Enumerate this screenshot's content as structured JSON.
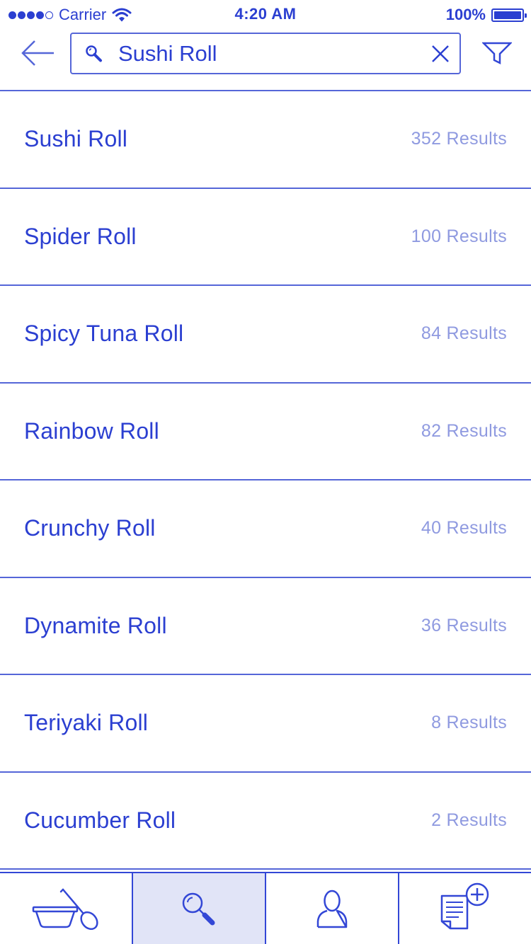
{
  "status_bar": {
    "carrier": "Carrier",
    "time": "4:20 AM",
    "battery": "100%",
    "battery_level": 1.0,
    "signal_bars_filled": 4,
    "signal_bars_total": 5
  },
  "header": {
    "search": {
      "value": "Sushi Roll",
      "icon": "search-icon"
    },
    "back_icon": "arrow-left-icon",
    "clear_icon": "close-icon",
    "filter_icon": "filter-icon"
  },
  "results": [
    {
      "label": "Sushi Roll",
      "count": "352 Results"
    },
    {
      "label": "Spider Roll",
      "count": "100 Results"
    },
    {
      "label": "Spicy Tuna Roll",
      "count": "84 Results"
    },
    {
      "label": "Rainbow Roll",
      "count": "82 Results"
    },
    {
      "label": "Crunchy Roll",
      "count": "40 Results"
    },
    {
      "label": "Dynamite Roll",
      "count": "36 Results"
    },
    {
      "label": "Teriyaki Roll",
      "count": "8 Results"
    },
    {
      "label": "Cucumber Roll",
      "count": "2 Results"
    }
  ],
  "tabs": [
    {
      "icon": "bowl-spoon-icon",
      "active": false
    },
    {
      "icon": "search-icon",
      "active": true
    },
    {
      "icon": "user-icon",
      "active": false
    },
    {
      "icon": "add-note-icon",
      "active": false
    }
  ],
  "colors": {
    "primary": "#2b3fd1",
    "divider": "#5566d8",
    "muted": "#8f9ae0",
    "active_tab_bg": "#e1e4f7"
  }
}
